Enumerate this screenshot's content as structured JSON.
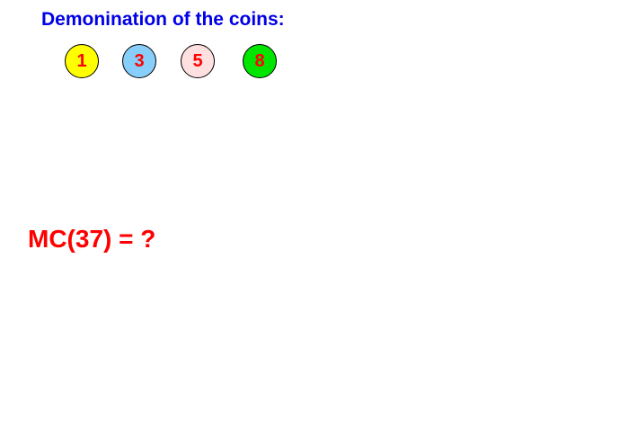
{
  "heading": "Demonination of the coins:",
  "coins": [
    {
      "value": "1",
      "color": "#ffff00"
    },
    {
      "value": "3",
      "color": "#87cefa"
    },
    {
      "value": "5",
      "color": "#ffe0e0"
    },
    {
      "value": "8",
      "color": "#00e600"
    }
  ],
  "question": "MC(37) = ?",
  "colors": {
    "heading": "#0000e6",
    "text": "#ff0000"
  }
}
